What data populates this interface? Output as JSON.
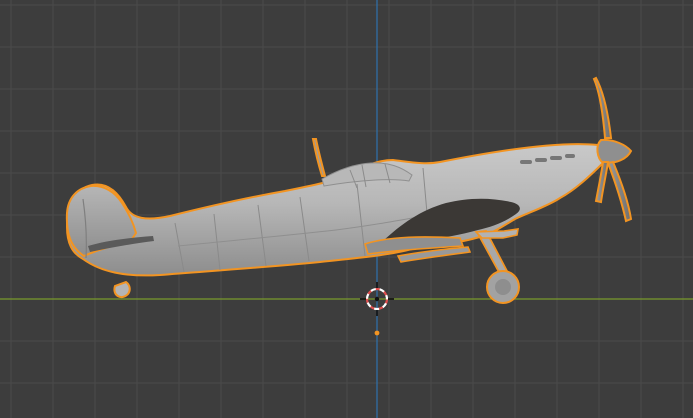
{
  "app": {
    "name": ""
  },
  "viewport": {
    "background": "#3d3d3d",
    "grid_color": "#4a4a4a",
    "x_axis_color": "#7a9a2c",
    "z_axis_color": "#2f6ea6",
    "selection_outline_color": "#f29422",
    "mesh_color_light": "#b9b9b9",
    "mesh_color_mid": "#9f9f9f",
    "mesh_color_dark": "#3b3835",
    "cursor": {
      "name": "3d-cursor",
      "ring_color_a": "#e04f4f",
      "ring_color_b": "#ffffff"
    },
    "object": {
      "name": "aircraft-mesh",
      "selected": true
    }
  }
}
